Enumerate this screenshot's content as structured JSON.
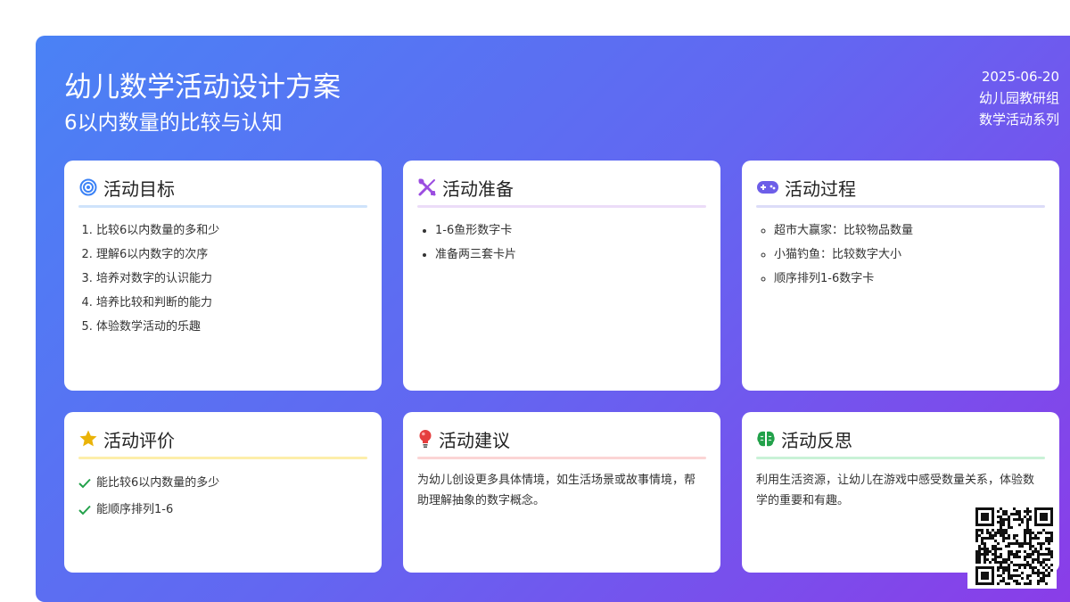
{
  "header": {
    "title": "幼儿数学活动设计方案",
    "subtitle": "6以内数量的比较与认知",
    "date": "2025-06-20",
    "org": "幼儿园教研组",
    "series": "数学活动系列"
  },
  "cards": {
    "goals": {
      "title": "活动目标",
      "icon": "target-icon",
      "accent": "#cfe3fb",
      "items": [
        "比较6以内数量的多和少",
        "理解6以内数字的次序",
        "培养对数字的认识能力",
        "培养比较和判断的能力",
        "体验数学活动的乐趣"
      ]
    },
    "prep": {
      "title": "活动准备",
      "icon": "tools-icon",
      "accent": "#ecdcf8",
      "items": [
        "1-6鱼形数字卡",
        "准备两三套卡片"
      ]
    },
    "process": {
      "title": "活动过程",
      "icon": "gamepad-icon",
      "accent": "#dcdcf8",
      "items": [
        "超市大赢家：比较物品数量",
        "小猫钓鱼：比较数字大小",
        "顺序排列1-6数字卡"
      ]
    },
    "eval": {
      "title": "活动评价",
      "icon": "star-icon",
      "accent": "#fdeeaa",
      "items": [
        "能比较6以内数量的多少",
        "能顺序排列1-6"
      ]
    },
    "suggest": {
      "title": "活动建议",
      "icon": "lightbulb-icon",
      "accent": "#fbd5d5",
      "text": "为幼儿创设更多具体情境，如生活场景或故事情境，帮助理解抽象的数字概念。"
    },
    "reflect": {
      "title": "活动反思",
      "icon": "brain-icon",
      "accent": "#c9f2d7",
      "text": "利用生活资源，让幼儿在游戏中感受数量关系，体验数学的重要和有趣。"
    }
  }
}
